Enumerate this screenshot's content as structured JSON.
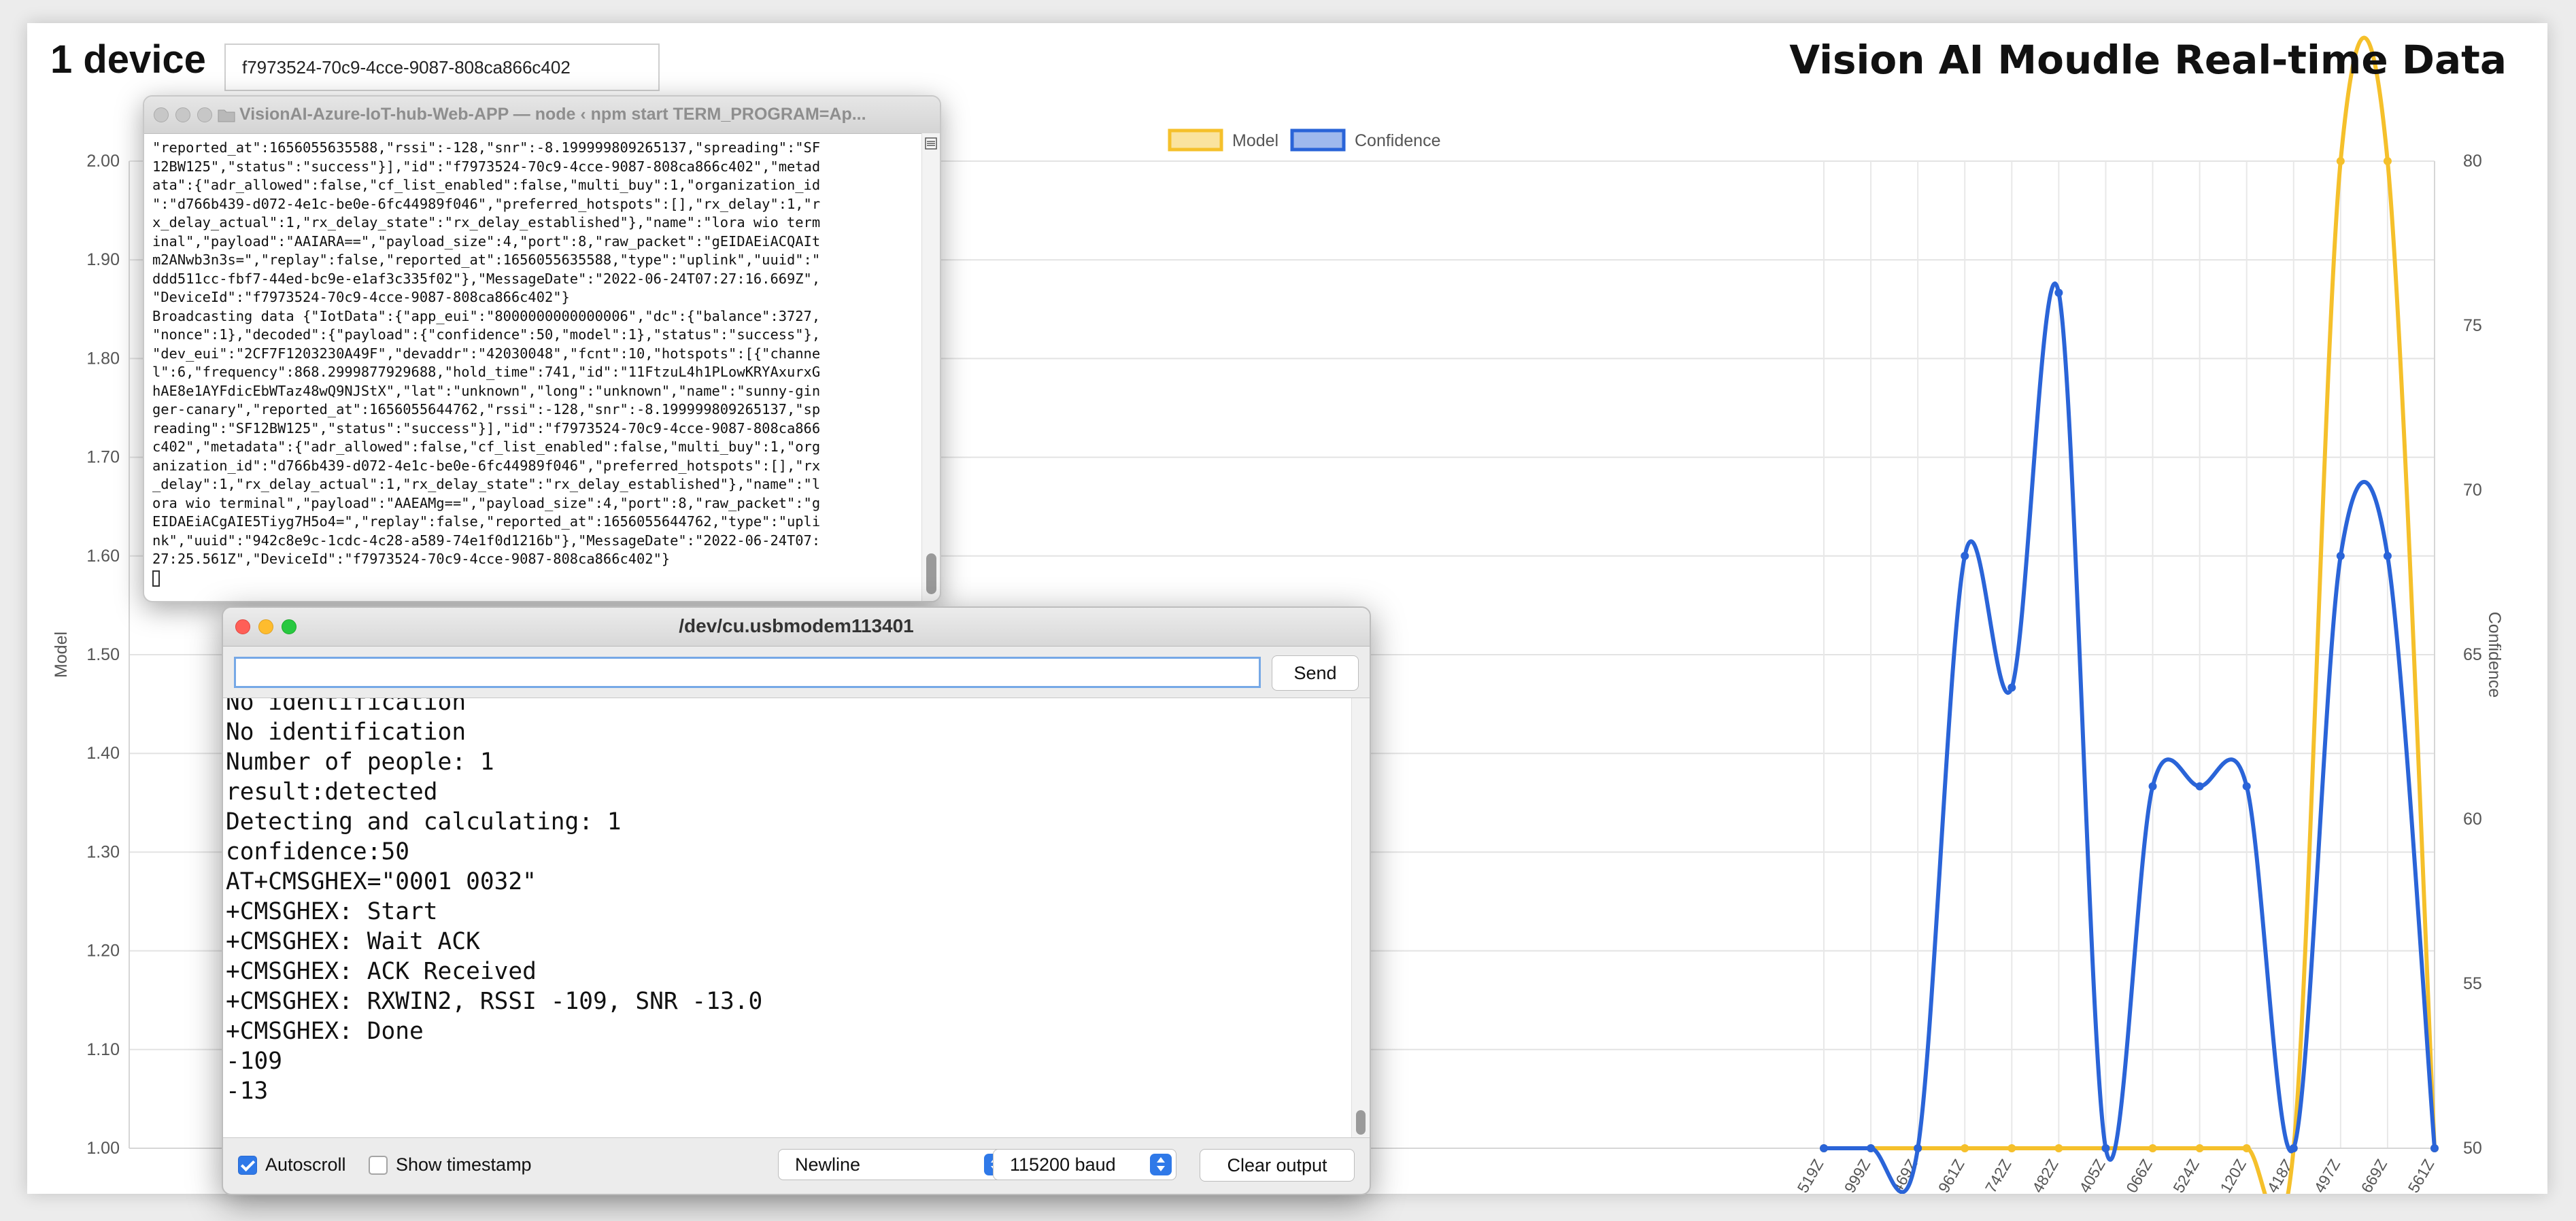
{
  "header": {
    "device_count": "1 device",
    "device_id": "f7973524-70c9-4cce-9087-808ca866c402",
    "title": "Vision AI Moudle Real-time Data"
  },
  "terminal": {
    "title": "VisionAI-Azure-IoT-hub-Web-APP — node ‹ npm start TERM_PROGRAM=Ap...",
    "lines": [
      "\"reported_at\":1656055635588,\"rssi\":-128,\"snr\":-8.199999809265137,\"spreading\":\"SF",
      "12BW125\",\"status\":\"success\"}],\"id\":\"f7973524-70c9-4cce-9087-808ca866c402\",\"metad",
      "ata\":{\"adr_allowed\":false,\"cf_list_enabled\":false,\"multi_buy\":1,\"organization_id",
      "\":\"d766b439-d072-4e1c-be0e-6fc44989f046\",\"preferred_hotspots\":[],\"rx_delay\":1,\"r",
      "x_delay_actual\":1,\"rx_delay_state\":\"rx_delay_established\"},\"name\":\"lora wio term",
      "inal\",\"payload\":\"AAIARA==\",\"payload_size\":4,\"port\":8,\"raw_packet\":\"gEIDAEiACQAIt",
      "m2ANwb3n3s=\",\"replay\":false,\"reported_at\":1656055635588,\"type\":\"uplink\",\"uuid\":\"",
      "ddd511cc-fbf7-44ed-bc9e-e1af3c335f02\"},\"MessageDate\":\"2022-06-24T07:27:16.669Z\",",
      "\"DeviceId\":\"f7973524-70c9-4cce-9087-808ca866c402\"}",
      "Broadcasting data {\"IotData\":{\"app_eui\":\"8000000000000006\",\"dc\":{\"balance\":3727,",
      "\"nonce\":1},\"decoded\":{\"payload\":{\"confidence\":50,\"model\":1},\"status\":\"success\"},",
      "\"dev_eui\":\"2CF7F1203230A49F\",\"devaddr\":\"42030048\",\"fcnt\":10,\"hotspots\":[{\"channe",
      "l\":6,\"frequency\":868.2999877929688,\"hold_time\":741,\"id\":\"11FtzuL4h1PLowKRYAxurxG",
      "hAE8e1AYFdicEbWTaz48wQ9NJStX\",\"lat\":\"unknown\",\"long\":\"unknown\",\"name\":\"sunny-gin",
      "ger-canary\",\"reported_at\":1656055644762,\"rssi\":-128,\"snr\":-8.199999809265137,\"sp",
      "reading\":\"SF12BW125\",\"status\":\"success\"}],\"id\":\"f7973524-70c9-4cce-9087-808ca866",
      "c402\",\"metadata\":{\"adr_allowed\":false,\"cf_list_enabled\":false,\"multi_buy\":1,\"org",
      "anization_id\":\"d766b439-d072-4e1c-be0e-6fc44989f046\",\"preferred_hotspots\":[],\"rx",
      "_delay\":1,\"rx_delay_actual\":1,\"rx_delay_state\":\"rx_delay_established\"},\"name\":\"l",
      "ora wio terminal\",\"payload\":\"AAEAMg==\",\"payload_size\":4,\"port\":8,\"raw_packet\":\"g",
      "EIDAEiACgAIE5Tiyg7H5o4=\",\"replay\":false,\"reported_at\":1656055644762,\"type\":\"upli",
      "nk\",\"uuid\":\"942c8e9c-1cdc-4c28-a589-74e1f0d1216b\"},\"MessageDate\":\"2022-06-24T07:",
      "27:25.561Z\",\"DeviceId\":\"f7973524-70c9-4cce-9087-808ca866c402\"}"
    ]
  },
  "serial": {
    "title": "/dev/cu.usbmodem113401",
    "input_value": "",
    "send_label": "Send",
    "output_lines": [
      "No identification",
      "No identification",
      "Number of people: 1",
      "result:detected",
      "Detecting and calculating: 1",
      "confidence:50",
      "AT+CMSGHEX=\"0001 0032\"",
      "+CMSGHEX: Start",
      "+CMSGHEX: Wait ACK",
      "+CMSGHEX: ACK Received",
      "+CMSGHEX: RXWIN2, RSSI -109, SNR -13.0",
      "+CMSGHEX: Done",
      "-109",
      "-13"
    ],
    "autoscroll_label": "Autoscroll",
    "autoscroll_checked": true,
    "timestamp_label": "Show timestamp",
    "timestamp_checked": false,
    "line_ending": "Newline",
    "baud": "115200 baud",
    "clear_label": "Clear output"
  },
  "chart_data": {
    "type": "line",
    "legend": [
      "Model",
      "Confidence"
    ],
    "legend_position": "top-center",
    "ylabel_left": "Model",
    "ylabel_right": "Confidence",
    "ylim_left": [
      1.0,
      2.0
    ],
    "ylim_right": [
      50,
      80
    ],
    "yticks_left": [
      "2.00",
      "1.90",
      "1.80",
      "1.70",
      "1.60",
      "1.50",
      "1.40",
      "1.30",
      "1.20",
      "1.10",
      "1.00"
    ],
    "yticks_right": [
      "80",
      "75",
      "70",
      "65",
      "60",
      "55",
      "50"
    ],
    "categories": [
      "519Z",
      "999Z",
      "469Z",
      "961Z",
      "742Z",
      "482Z",
      "405Z",
      "066Z",
      "524Z",
      "120Z",
      "418Z",
      "497Z",
      "669Z",
      "561Z"
    ],
    "series": [
      {
        "name": "Model",
        "axis": "left",
        "color": "#f5c02b",
        "values": [
          1,
          1,
          1,
          1,
          1,
          1,
          1,
          1,
          1,
          1,
          1,
          2,
          2,
          1
        ]
      },
      {
        "name": "Confidence",
        "axis": "right",
        "color": "#2a64d8",
        "values": [
          50,
          50,
          50,
          68,
          64,
          76,
          50,
          61,
          61,
          61,
          50,
          68,
          68,
          50
        ]
      }
    ],
    "grid": true
  }
}
